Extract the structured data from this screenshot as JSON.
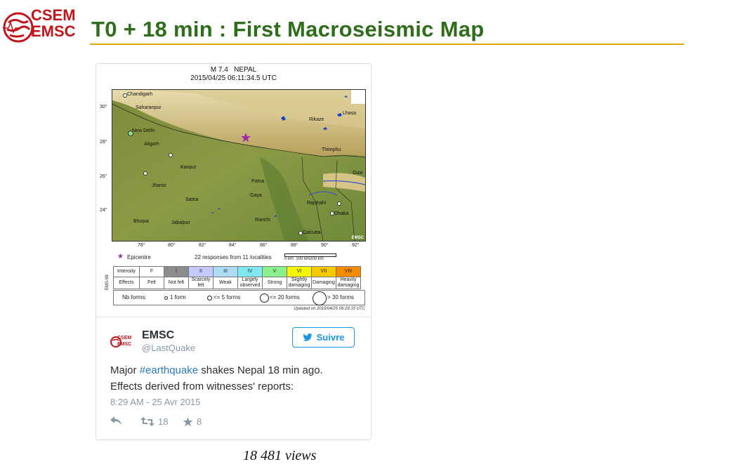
{
  "header": {
    "logo_line1": "CSEM",
    "logo_line2": "EMSC",
    "title": "T0 + 18 min : First Macroseismic Map",
    "accent_color": "#e4a300",
    "title_color": "#2e6e1a"
  },
  "map": {
    "event": "M 7.4   NEPAL",
    "datetime": "2015/04/25 06:11:34.5 UTC",
    "lat_labels": [
      "30°",
      "28°",
      "26°",
      "24°"
    ],
    "lon_labels": [
      "78°",
      "80°",
      "82°",
      "84°",
      "86°",
      "88°",
      "90°",
      "92°"
    ],
    "cities": [
      "Chandigarh",
      "Saharanpur",
      "New Delhi",
      "Aligarh",
      "Kanpur",
      "Jhansi",
      "Satna",
      "Bhopal",
      "Jabalpur",
      "Patna",
      "Gaya",
      "Ranchi",
      "Calcutta",
      "Dhaka",
      "Rajshahi",
      "Thimphu",
      "Rikaze",
      "Lhasa",
      "Guw"
    ],
    "watermark": "EMSC",
    "legend_epicentre": "Epicentre",
    "legend_responses": "22 responses from 11 localities",
    "scale_label": "0 km  100 km200 km",
    "ems_label": "EMS-98",
    "intensity_header": "Intensity",
    "effects_header": "Effects",
    "intensities": [
      {
        "level": "F",
        "effect": "Felt",
        "color": "#ffffff"
      },
      {
        "level": "I",
        "effect": "Not felt",
        "color": "#8c8c8c"
      },
      {
        "level": "II",
        "effect": "Scarcely felt",
        "color": "#c5c9ff"
      },
      {
        "level": "III",
        "effect": "Weak",
        "color": "#aedcf5"
      },
      {
        "level": "IV",
        "effect": "Largely observed",
        "color": "#7fe8f0"
      },
      {
        "level": "V",
        "effect": "Strong",
        "color": "#8cf08c"
      },
      {
        "level": "VI",
        "effect": "Slightly damaging",
        "color": "#f5f500"
      },
      {
        "level": "VII",
        "effect": "Damaging",
        "color": "#f5c800"
      },
      {
        "level": "VIII",
        "effect": "Heavily damaging",
        "color": "#f58c00"
      }
    ],
    "nb_forms_label": "Nb forms:",
    "form_1": "1 form",
    "form_5": "<= 5 forms",
    "form_20": "<= 20 forms",
    "form_30": "> 30 forms",
    "updated": "Updated on 2015/04/25 06:29:15 UTC"
  },
  "tweet": {
    "name": "EMSC",
    "handle": "@LastQuake",
    "follow_label": "Suivre",
    "text_before": "Major ",
    "hashtag": "#earthquake",
    "text_after": " shakes Nepal 18 min ago. Effects derived from witnesses' reports:",
    "timestamp": "8:29 AM - 25 Avr 2015",
    "retweets": "18",
    "favorites": "8",
    "link_color": "#2b7bb9"
  },
  "views": "18 481 views"
}
